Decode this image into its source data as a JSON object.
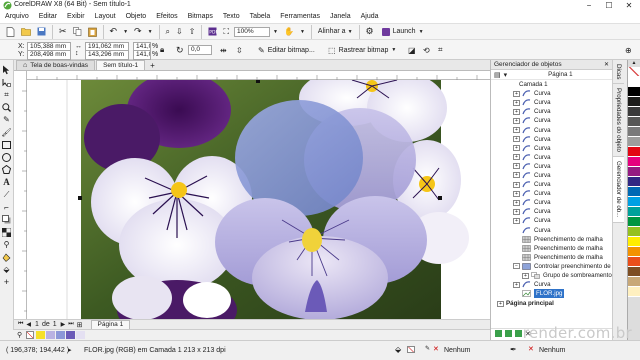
{
  "window": {
    "title": "CorelDRAW X8 (64 Bit) - Sem título-1",
    "controls": {
      "minimize": "−",
      "maximize": "☐",
      "close": "✕"
    }
  },
  "menu": [
    "Arquivo",
    "Editar",
    "Exibir",
    "Layout",
    "Objeto",
    "Efeitos",
    "Bitmaps",
    "Texto",
    "Tabela",
    "Ferramentas",
    "Janela",
    "Ajuda"
  ],
  "standard_toolbar": {
    "zoom_value": "100%",
    "snap_label": "Alinhar a",
    "launch_label": "Launch"
  },
  "property_bar": {
    "x_label": "X:",
    "x_value": "105,388 mm",
    "y_label": "Y:",
    "y_value": "208,498 mm",
    "w_value": "191,062 mm",
    "h_value": "143,296 mm",
    "scale_w": "141,0",
    "scale_h": "141,0",
    "percent": "%",
    "angle_value": "0,0",
    "edit_bitmap_label": "Editar bitmap...",
    "trace_bitmap_label": "Rastrear bitmap"
  },
  "doc_tabs": [
    {
      "label": "Tela de boas-vindas"
    },
    {
      "label": "Sem título-1"
    }
  ],
  "object_manager": {
    "title": "Gerenciador de objetos",
    "page_label": "Página 1",
    "layer_label": "Camada 1",
    "items": [
      "Curva",
      "Curva",
      "Curva",
      "Curva",
      "Curva",
      "Curva",
      "Curva",
      "Curva",
      "Curva",
      "Curva",
      "Curva",
      "Curva",
      "Curva",
      "Curva",
      "Curva",
      "Curva",
      "Preenchimento de malha",
      "Preenchimento de malha",
      "Preenchimento de malha",
      "Controlar preenchimento de",
      "Grupo de sombreamento",
      "Curva"
    ],
    "selected_item": "FLOR.jpg",
    "main_page": "Página principal"
  },
  "side_tabs": [
    "Dicas",
    "Propriedades do objeto",
    "Gerenciador de ob..."
  ],
  "page_nav": {
    "current": "1",
    "of_label": "de",
    "total": "1",
    "page_tab": "Página 1"
  },
  "statusbar": {
    "coords": "( 196,378; 194,442 )",
    "info": "FLOR.jpg (RGB) em Camada 1 213 x 213 dpi",
    "fill_label": "Nenhum",
    "outline_label": "Nenhum"
  },
  "watermark": "render.com.br",
  "palette_colors": [
    "#ffffff",
    "#000000",
    "#1d1d1b",
    "#3a3a3a",
    "#575756",
    "#7a7a7a",
    "#9d9d9c",
    "#e30613",
    "#e6007e",
    "#951b81",
    "#312783",
    "#0069b4",
    "#00a0e3",
    "#00a19a",
    "#009640",
    "#95c11f",
    "#ffed00",
    "#f39200",
    "#e94e1b",
    "#7d4e24",
    "#c8a878",
    "#fff0c0"
  ]
}
